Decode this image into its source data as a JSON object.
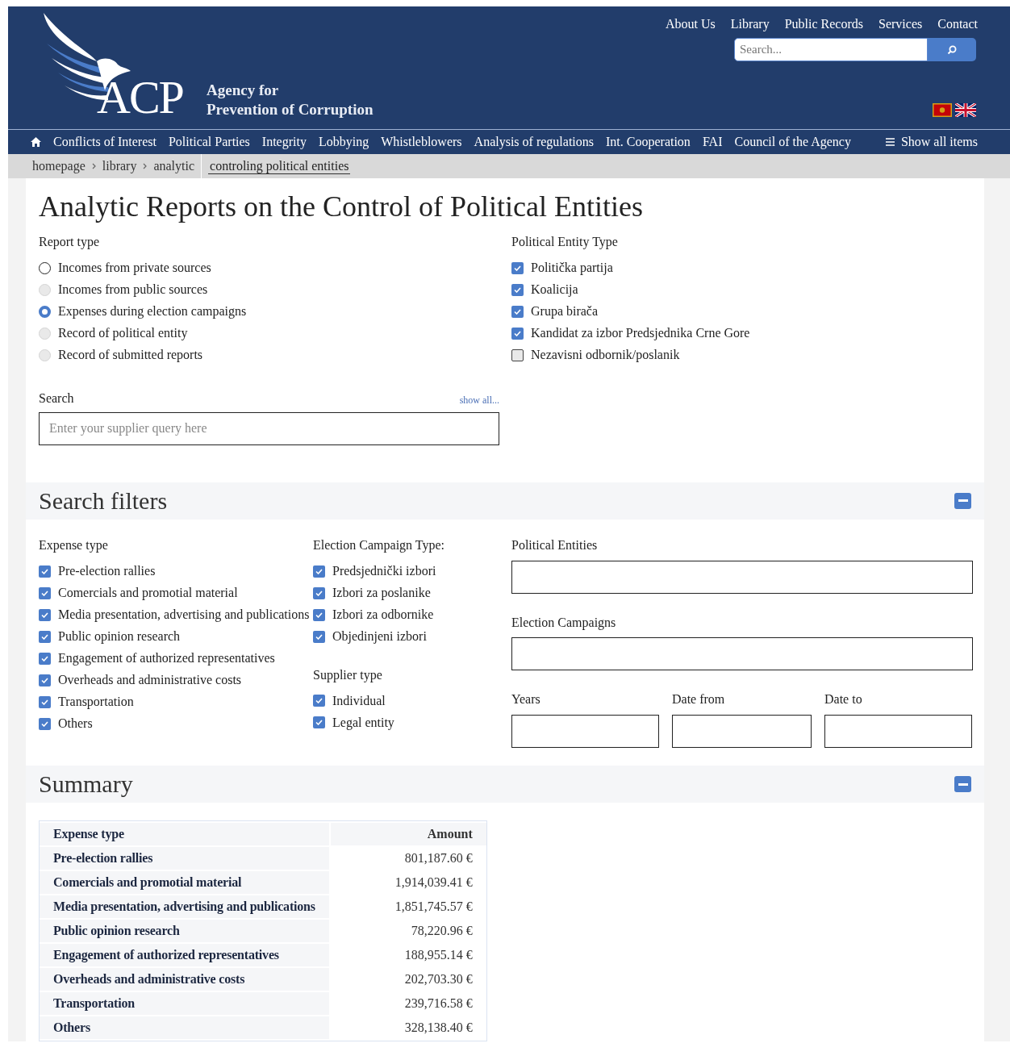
{
  "top_links": [
    {
      "label": "About Us"
    },
    {
      "label": "Library"
    },
    {
      "label": "Public Records"
    },
    {
      "label": "Services"
    },
    {
      "label": "Contact"
    }
  ],
  "header_search": {
    "placeholder": "Search..."
  },
  "logo": {
    "abbr": "ACP",
    "line1": "Agency for",
    "line2": "Prevention of Corruption"
  },
  "main_nav": [
    {
      "label": "Conflicts of Interest"
    },
    {
      "label": "Political Parties"
    },
    {
      "label": "Integrity"
    },
    {
      "label": "Lobbying"
    },
    {
      "label": "Whistleblowers"
    },
    {
      "label": "Analysis of regulations"
    },
    {
      "label": "Int. Cooperation"
    },
    {
      "label": "FAI"
    },
    {
      "label": "Council of the Agency"
    }
  ],
  "show_all": "Show all items",
  "breadcrumb": [
    {
      "label": "homepage"
    },
    {
      "label": "library"
    },
    {
      "label": "analytic"
    }
  ],
  "breadcrumb_current": "controling political entities",
  "title": "Analytic Reports on the Control of Political Entities",
  "report_type": {
    "label": "Report type",
    "options": [
      {
        "label": "Incomes from private sources",
        "selected": false,
        "disabled": false
      },
      {
        "label": "Incomes from public sources",
        "selected": false,
        "disabled": true
      },
      {
        "label": "Expenses during election campaigns",
        "selected": true,
        "disabled": false
      },
      {
        "label": "Record of political entity",
        "selected": false,
        "disabled": true
      },
      {
        "label": "Record of submitted reports",
        "selected": false,
        "disabled": true
      }
    ]
  },
  "entity_type": {
    "label": "Political Entity Type",
    "options": [
      {
        "label": "Politička partija",
        "checked": true
      },
      {
        "label": "Koalicija",
        "checked": true
      },
      {
        "label": "Grupa birača",
        "checked": true
      },
      {
        "label": "Kandidat za izbor Predsjednika Crne Gore",
        "checked": true
      },
      {
        "label": "Nezavisni odbornik/poslanik",
        "checked": false
      }
    ]
  },
  "search": {
    "label": "Search",
    "show_all": "show all...",
    "placeholder": "Enter your supplier query here"
  },
  "filters": {
    "title": "Search filters",
    "expanded": true,
    "expense_type": {
      "label": "Expense type",
      "options": [
        {
          "label": "Pre-election rallies",
          "checked": true
        },
        {
          "label": "Comercials and promotial material",
          "checked": true
        },
        {
          "label": "Media presentation, advertising and publications",
          "checked": true
        },
        {
          "label": "Public opinion research",
          "checked": true
        },
        {
          "label": "Engagement of authorized representatives",
          "checked": true
        },
        {
          "label": "Overheads and administrative costs",
          "checked": true
        },
        {
          "label": "Transportation",
          "checked": true
        },
        {
          "label": "Others",
          "checked": true
        }
      ]
    },
    "campaign_type": {
      "label": "Election Campaign Type:",
      "options": [
        {
          "label": "Predsjednički izbori",
          "checked": true
        },
        {
          "label": "Izbori za poslanike",
          "checked": true
        },
        {
          "label": "Izbori za odbornike",
          "checked": true
        },
        {
          "label": "Objedinjeni izbori",
          "checked": true
        }
      ]
    },
    "supplier_type": {
      "label": "Supplier type",
      "options": [
        {
          "label": "Individual",
          "checked": true
        },
        {
          "label": "Legal entity",
          "checked": true
        }
      ]
    },
    "political_entities": {
      "label": "Political Entities"
    },
    "election_campaigns": {
      "label": "Election Campaigns"
    },
    "years": {
      "label": "Years"
    },
    "date_from": {
      "label": "Date from"
    },
    "date_to": {
      "label": "Date to"
    }
  },
  "summary": {
    "title": "Summary",
    "expanded": true,
    "table": {
      "columns": [
        "Expense type",
        "Amount"
      ],
      "rows": [
        [
          "Pre-election rallies",
          "801,187.60 €"
        ],
        [
          "Comercials and promotial material",
          "1,914,039.41 €"
        ],
        [
          "Media presentation, advertising and publications",
          "1,851,745.57 €"
        ],
        [
          "Public opinion research",
          "78,220.96 €"
        ],
        [
          "Engagement of authorized representatives",
          "188,955.14 €"
        ],
        [
          "Overheads and administrative costs",
          "202,703.30 €"
        ],
        [
          "Transportation",
          "239,716.58 €"
        ],
        [
          "Others",
          "328,138.40 €"
        ]
      ]
    }
  }
}
